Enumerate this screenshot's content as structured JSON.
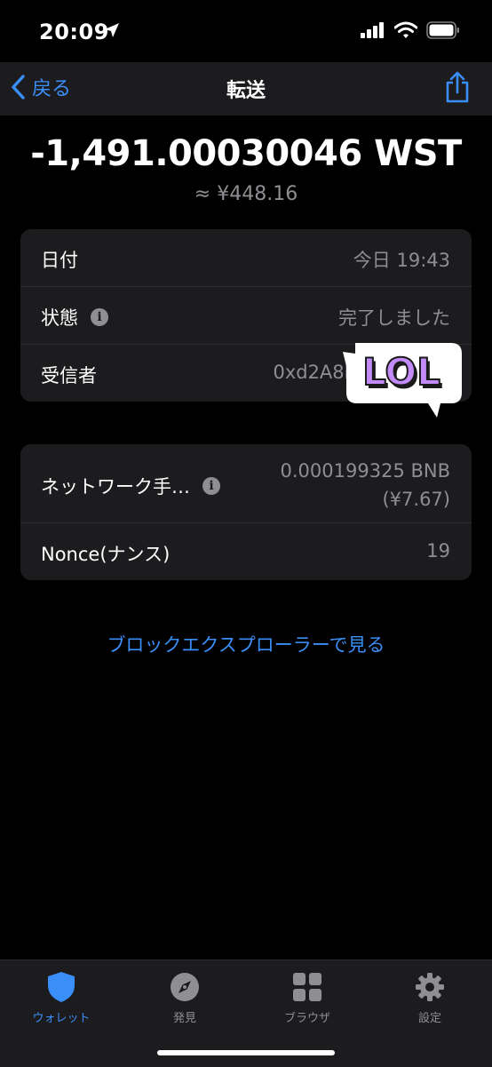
{
  "status_bar": {
    "time": "20:09"
  },
  "nav": {
    "back_label": "戻る",
    "title": "転送"
  },
  "amount": "-1,491.00030046 WST",
  "fiat_value": "≈ ¥448.16",
  "details": [
    {
      "label": "日付",
      "value": "今日 19:43"
    },
    {
      "label": "状態",
      "value": "完了しました"
    },
    {
      "label": "受信者",
      "value": "0xd2A8b"
    }
  ],
  "fees": [
    {
      "label": "ネットワーク手…",
      "value_line1": "0.000199325 BNB",
      "value_line2": "(¥7.67)"
    },
    {
      "label": "Nonce(ナンス)",
      "value": "19"
    }
  ],
  "sticker_text": "LOL",
  "explorer_link": "ブロックエクスプローラーで見る",
  "tabs": [
    {
      "label": "ウォレット",
      "icon": "shield-icon",
      "active": true
    },
    {
      "label": "発見",
      "icon": "compass-icon",
      "active": false
    },
    {
      "label": "ブラウザ",
      "icon": "grid-icon",
      "active": false
    },
    {
      "label": "設定",
      "icon": "gear-icon",
      "active": false
    }
  ],
  "colors": {
    "accent": "#3a8ef7",
    "card": "#1c1c1e",
    "secondary_text": "#8e8e93",
    "sticker": "#c38af9"
  }
}
